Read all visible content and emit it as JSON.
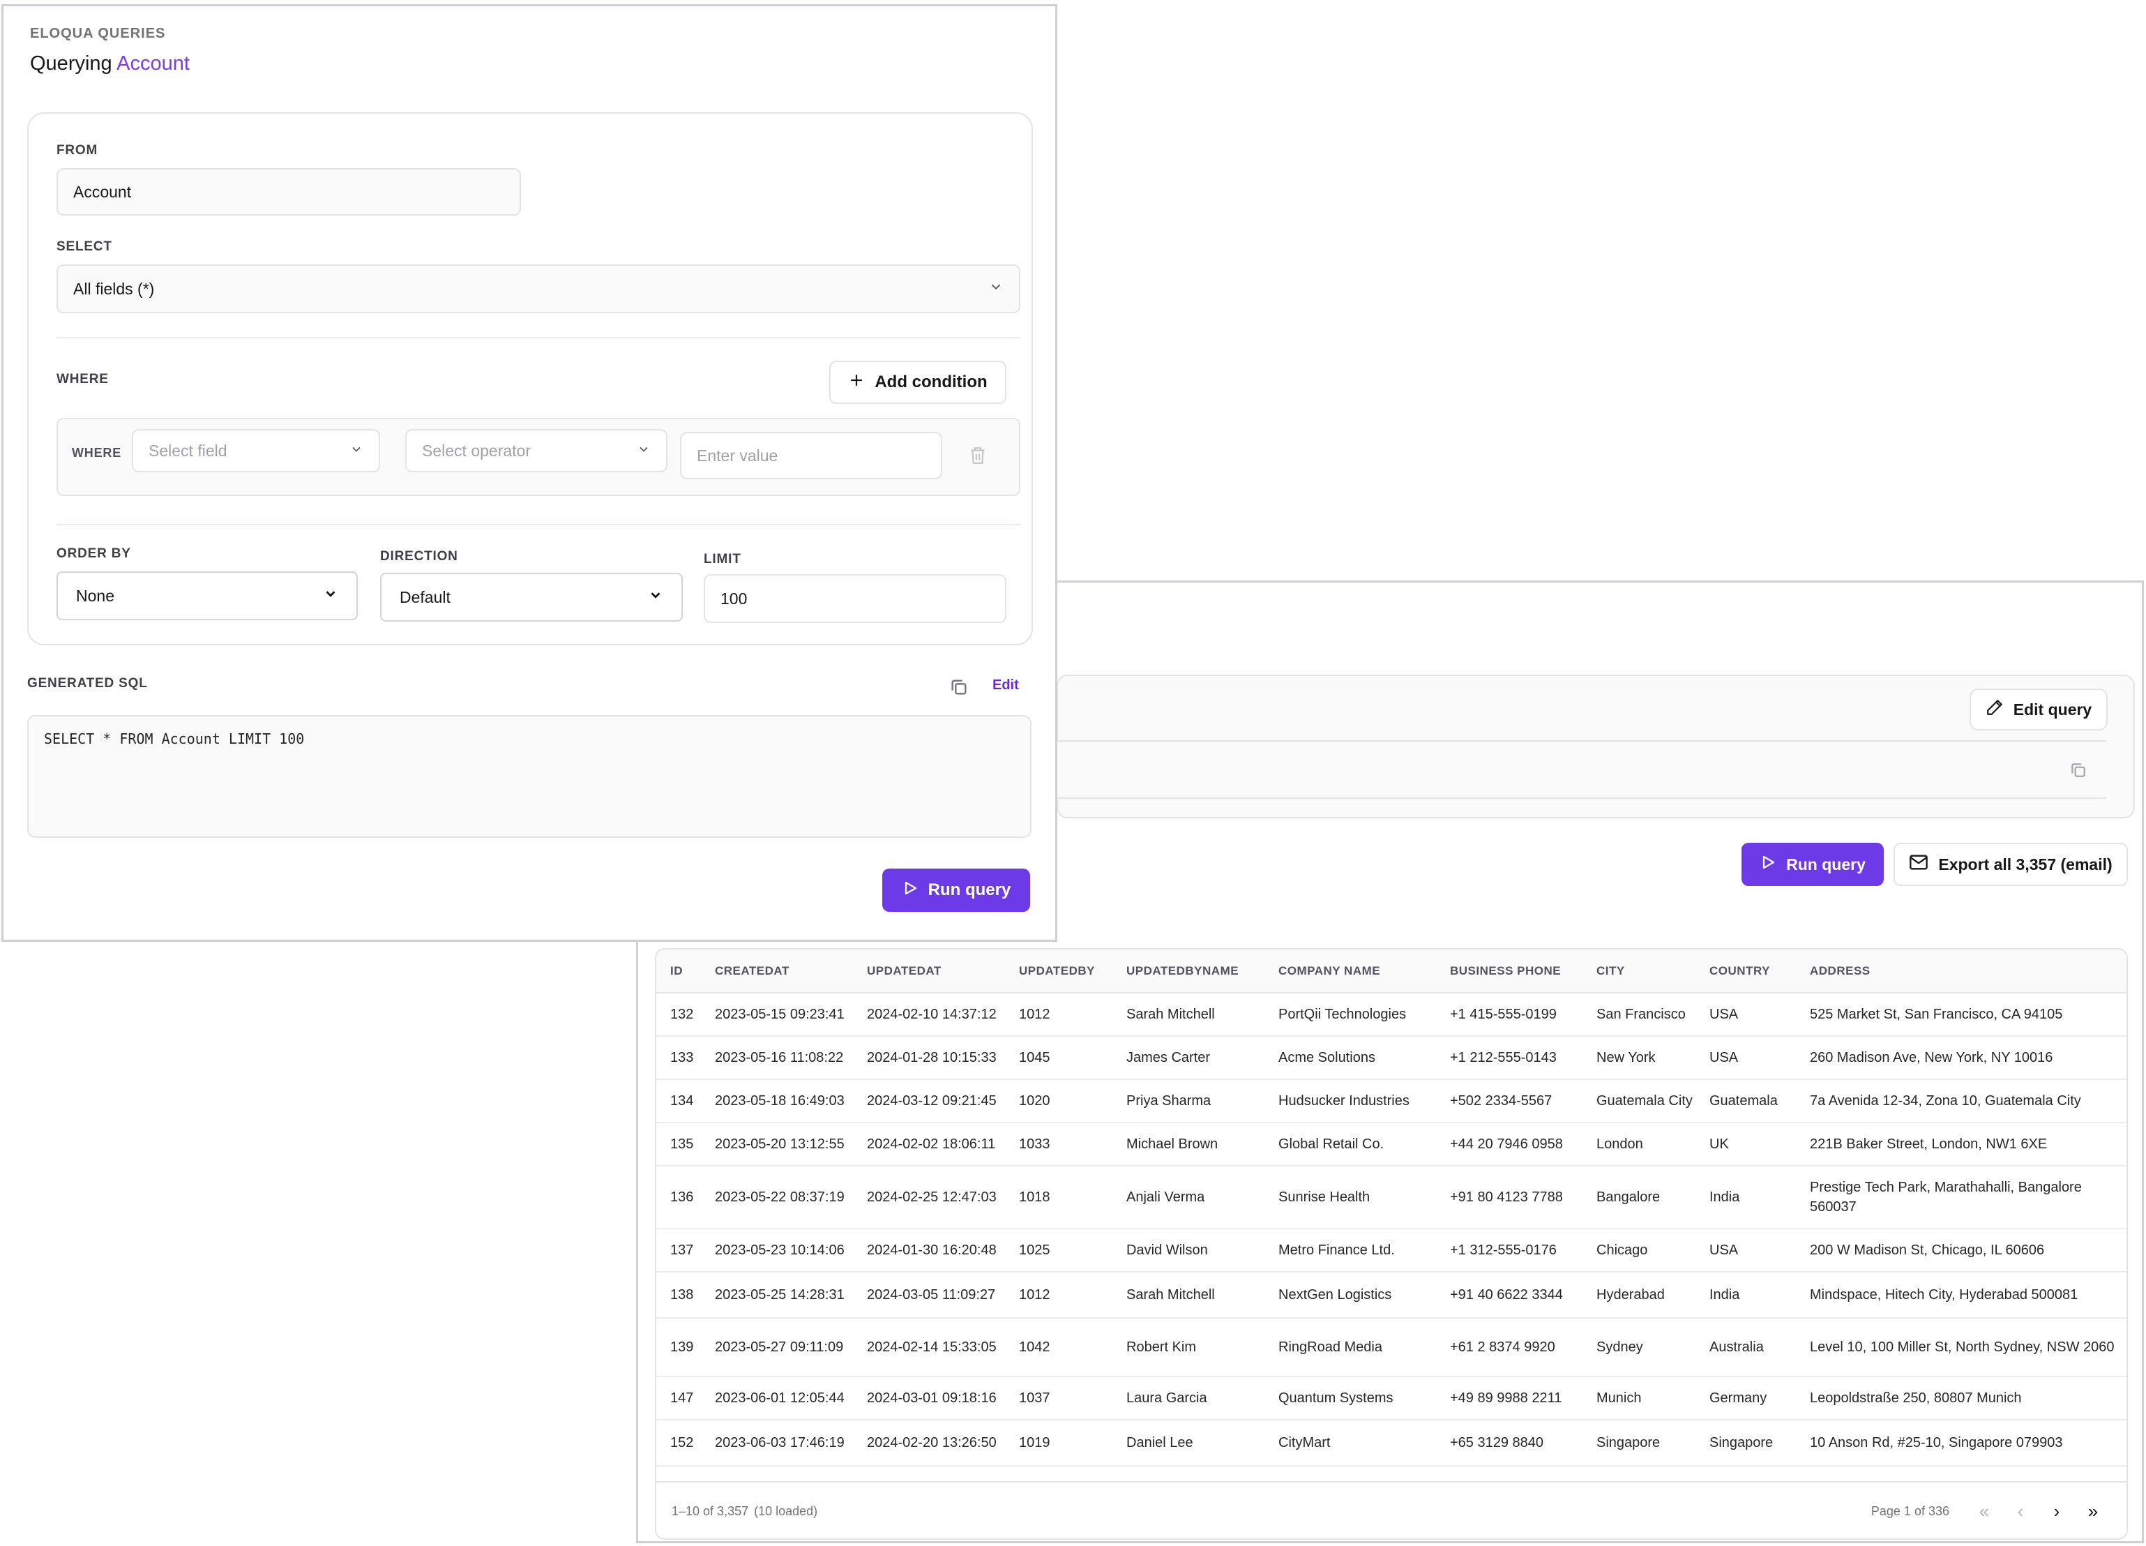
{
  "query_builder": {
    "eyebrow": "ELOQUA QUERIES",
    "title_prefix": "Querying",
    "title_object": "Account",
    "from": {
      "label": "FROM",
      "value": "Account"
    },
    "select": {
      "label": "SELECT",
      "value": "All fields (*)"
    },
    "where": {
      "label": "WHERE",
      "add_condition_label": "Add condition",
      "row_label": "WHERE",
      "field_placeholder": "Select field",
      "operator_placeholder": "Select operator",
      "value_placeholder": "Enter value"
    },
    "order_by": {
      "label": "ORDER BY",
      "value": "None"
    },
    "direction": {
      "label": "DIRECTION",
      "value": "Default"
    },
    "limit": {
      "label": "LIMIT",
      "value": "100"
    },
    "generated_sql": {
      "label": "GENERATED SQL",
      "edit_label": "Edit",
      "sql": "SELECT * FROM Account LIMIT 100"
    },
    "run_label": "Run query"
  },
  "results": {
    "edit_query_label": "Edit query",
    "run_label": "Run query",
    "export_label": "Export all 3,357 (email)",
    "columns": [
      "ID",
      "CREATEDAT",
      "UPDATEDAT",
      "UPDATEDBY",
      "UPDATEDBYNAME",
      "COMPANY NAME",
      "BUSINESS PHONE",
      "CITY",
      "COUNTRY",
      "ADDRESS"
    ],
    "rows": [
      [
        "132",
        "2023-05-15 09:23:41",
        "2024-02-10 14:37:12",
        "1012",
        "Sarah Mitchell",
        "PortQii Technologies",
        "+1 415-555-0199",
        "San Francisco",
        "USA",
        "525 Market St, San Francisco, CA 94105"
      ],
      [
        "133",
        "2023-05-16 11:08:22",
        "2024-01-28 10:15:33",
        "1045",
        "James Carter",
        "Acme Solutions",
        "+1 212-555-0143",
        "New York",
        "USA",
        "260 Madison Ave, New York, NY 10016"
      ],
      [
        "134",
        "2023-05-18 16:49:03",
        "2024-03-12 09:21:45",
        "1020",
        "Priya Sharma",
        "Hudsucker Industries",
        "+502 2334-5567",
        "Guatemala City",
        "Guatemala",
        "7a Avenida 12-34, Zona 10, Guatemala City"
      ],
      [
        "135",
        "2023-05-20 13:12:55",
        "2024-02-02 18:06:11",
        "1033",
        "Michael Brown",
        "Global Retail Co.",
        "+44 20 7946 0958",
        "London",
        "UK",
        "221B Baker Street, London, NW1 6XE"
      ],
      [
        "136",
        "2023-05-22 08:37:19",
        "2024-02-25 12:47:03",
        "1018",
        "Anjali Verma",
        "Sunrise Health",
        "+91 80 4123 7788",
        "Bangalore",
        "India",
        "Prestige Tech Park, Marathahalli, Bangalore 560037"
      ],
      [
        "137",
        "2023-05-23 10:14:06",
        "2024-01-30 16:20:48",
        "1025",
        "David Wilson",
        "Metro Finance Ltd.",
        "+1 312-555-0176",
        "Chicago",
        "USA",
        "200 W Madison St, Chicago, IL 60606"
      ],
      [
        "138",
        "2023-05-25 14:28:31",
        "2024-03-05 11:09:27",
        "1012",
        "Sarah Mitchell",
        "NextGen Logistics",
        "+91 40 6622 3344",
        "Hyderabad",
        "India",
        "Mindspace, Hitech City, Hyderabad 500081"
      ],
      [
        "139",
        "2023-05-27 09:11:09",
        "2024-02-14 15:33:05",
        "1042",
        "Robert Kim",
        "RingRoad Media",
        "+61 2 8374 9920",
        "Sydney",
        "Australia",
        "Level 10, 100 Miller St, North Sydney, NSW 2060"
      ],
      [
        "147",
        "2023-06-01 12:05:44",
        "2024-03-01 09:18:16",
        "1037",
        "Laura Garcia",
        "Quantum Systems",
        "+49 89 9988 2211",
        "Munich",
        "Germany",
        "Leopoldstraße 250, 80807 Munich"
      ],
      [
        "152",
        "2023-06-03 17:46:19",
        "2024-02-20 13:26:50",
        "1019",
        "Daniel Lee",
        "CityMart",
        "+65 3129 8840",
        "Singapore",
        "Singapore",
        "10 Anson Rd, #25-10, Singapore 079903"
      ]
    ],
    "footer_range": "1–10 of 3,357",
    "footer_loaded": "(10 loaded)",
    "page_label": "Page 1 of 336",
    "pager": {
      "first": "«",
      "prev": "‹",
      "next": "›",
      "last": "»"
    }
  },
  "colors": {
    "accent": "#6d3ae8",
    "accent_text": "#7c3aed",
    "border": "#e4e4e7"
  }
}
